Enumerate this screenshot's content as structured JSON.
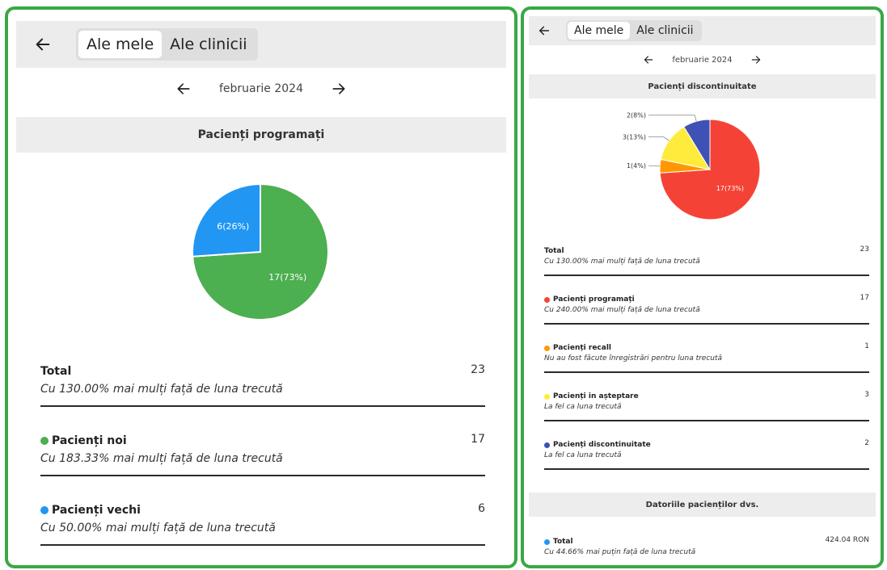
{
  "left": {
    "tabs": [
      "Ale mele",
      "Ale clinicii"
    ],
    "month": "februarie 2024",
    "section_title": "Pacienți programați",
    "pie": {
      "type": "pie",
      "slices": [
        {
          "name": "Pacienți noi",
          "value": 17,
          "label": "17(73%)",
          "color": "#4caf50"
        },
        {
          "name": "Pacienți vechi",
          "value": 6,
          "label": "6(26%)",
          "color": "#2196f3"
        }
      ]
    },
    "rows": [
      {
        "label": "Total",
        "value": "23",
        "sub": "Cu 130.00% mai mulți față de luna trecută",
        "dot": ""
      },
      {
        "label": "Pacienți noi",
        "value": "17",
        "sub": "Cu 183.33% mai mulți față de luna trecută",
        "dot": "#4caf50"
      },
      {
        "label": "Pacienți vechi",
        "value": "6",
        "sub": "Cu 50.00% mai mulți față de luna trecută",
        "dot": "#2196f3"
      }
    ]
  },
  "right": {
    "tabs": [
      "Ale mele",
      "Ale clinicii"
    ],
    "month": "februarie 2024",
    "section_title": "Pacienți discontinuitate",
    "pie": {
      "type": "pie",
      "slices": [
        {
          "name": "Pacienți programați",
          "value": 17,
          "label": "17(73%)",
          "color": "#f44336"
        },
        {
          "name": "Pacienți recall",
          "value": 1,
          "label": "1(4%)",
          "color": "#ff9800"
        },
        {
          "name": "Pacienți in așteptare",
          "value": 3,
          "label": "3(13%)",
          "color": "#ffeb3b"
        },
        {
          "name": "Pacienți discontinuitate",
          "value": 2,
          "label": "2(8%)",
          "color": "#3f51b5"
        }
      ]
    },
    "rows": [
      {
        "label": "Total",
        "value": "23",
        "sub": "Cu 130.00% mai mulți față de luna trecută",
        "dot": ""
      },
      {
        "label": "Pacienți programați",
        "value": "17",
        "sub": "Cu 240.00% mai mulți față de luna trecută",
        "dot": "#f44336"
      },
      {
        "label": "Pacienți recall",
        "value": "1",
        "sub": "Nu au fost făcute înregistrări pentru luna trecută",
        "dot": "#ff9800"
      },
      {
        "label": "Pacienți in așteptare",
        "value": "3",
        "sub": "La fel ca luna trecută",
        "dot": "#ffeb3b"
      },
      {
        "label": "Pacienți discontinuitate",
        "value": "2",
        "sub": "La fel ca luna trecută",
        "dot": "#3f51b5"
      }
    ],
    "section2_title": "Datoriile pacienților dvs.",
    "debt_row": {
      "label": "Total",
      "value": "424.04 RON",
      "sub": "Cu 44.66% mai puțin față de luna trecută",
      "dot": "#2196f3"
    }
  },
  "chart_data": [
    {
      "type": "pie",
      "categories": [
        "Pacienți noi",
        "Pacienți vechi"
      ],
      "values": [
        17,
        6
      ]
    },
    {
      "type": "pie",
      "categories": [
        "Pacienți programați",
        "Pacienți recall",
        "Pacienți in așteptare",
        "Pacienți discontinuitate"
      ],
      "values": [
        17,
        1,
        3,
        2
      ]
    }
  ]
}
